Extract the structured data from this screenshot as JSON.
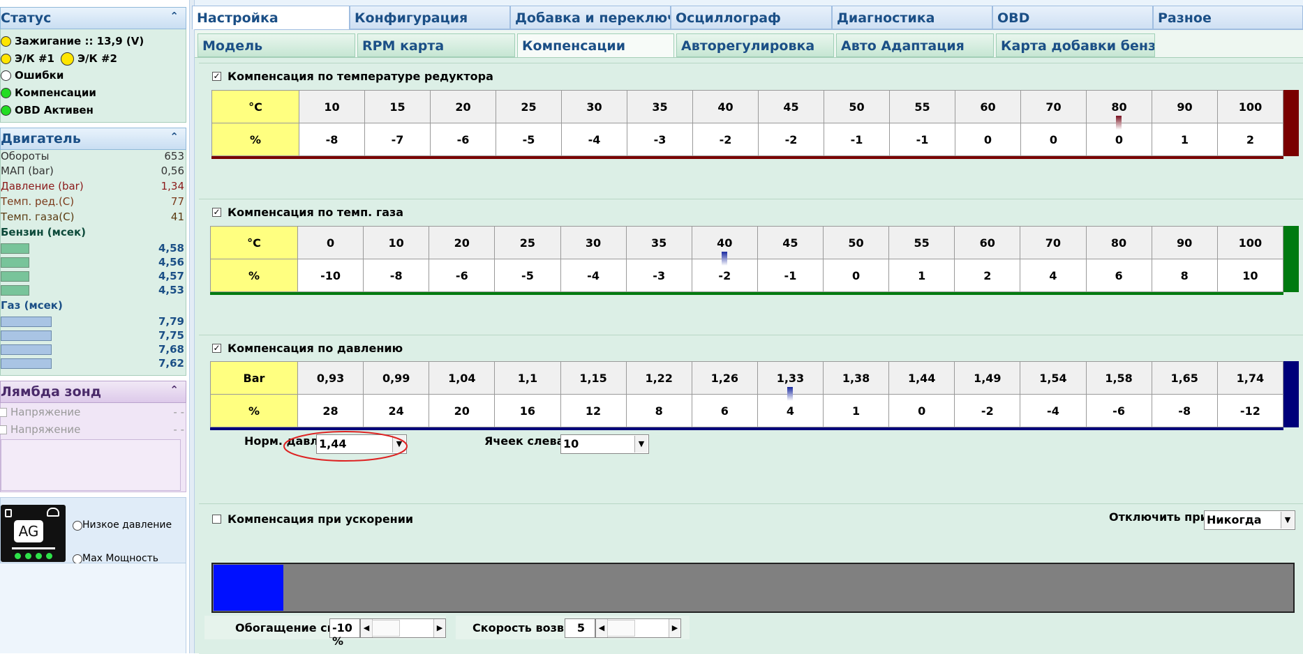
{
  "status": {
    "title": "Статус",
    "ignition": "Зажигание :: 13,9 (V)",
    "ek1": "Э/К #1",
    "ek2": "Э/К #2",
    "errors": "Ошибки",
    "compensation": "Компенсации",
    "obd": "OBD Активен"
  },
  "engine": {
    "title": "Двигатель",
    "rows": [
      {
        "label": "Обороты",
        "value": "653"
      },
      {
        "label": "МАП (bar)",
        "value": "0,56"
      },
      {
        "label": "Давление (bar)",
        "value": "1,34"
      },
      {
        "label": "Темп. ред.(C)",
        "value": "77"
      },
      {
        "label": "Темп. газа(C)",
        "value": "41"
      }
    ],
    "petrol_title": "Бензин (мсек)",
    "petrol": [
      "4,58",
      "4,56",
      "4,57",
      "4,53"
    ],
    "gas_title": "Газ (мсек)",
    "gas": [
      "7,79",
      "7,75",
      "7,68",
      "7,62"
    ]
  },
  "lambda": {
    "title": "Лямбда зонд",
    "rows": [
      {
        "label": "Напряжение",
        "value": "- -"
      },
      {
        "label": "Напряжение",
        "value": "- -"
      }
    ]
  },
  "device": {
    "logo": "AG",
    "low_pressure": "Низкое давление",
    "max_power": "Max Мощность"
  },
  "tabs": [
    "Настройка",
    "Конфигурация",
    "Добавка и переключен",
    "Осциллограф",
    "Диагностика",
    "OBD",
    "Разное"
  ],
  "subtabs": [
    "Модель",
    "RPM карта",
    "Компенсации",
    "Авторегулировка",
    "Авто Адаптация",
    "Карта добавки бензина"
  ],
  "reducer": {
    "title": "Компенсация по температуре редуктора",
    "checked": true,
    "row1_label": "°C",
    "row2_label": "%",
    "x": [
      "10",
      "15",
      "20",
      "25",
      "30",
      "35",
      "40",
      "45",
      "50",
      "55",
      "60",
      "70",
      "80",
      "90",
      "100"
    ],
    "y": [
      "-8",
      "-7",
      "-6",
      "-5",
      "-4",
      "-3",
      "-2",
      "-2",
      "-1",
      "-1",
      "0",
      "0",
      "0",
      "1",
      "2"
    ],
    "color": "#7a0000"
  },
  "gas_temp": {
    "title": "Компенсация по темп. газа",
    "checked": true,
    "row1_label": "°C",
    "row2_label": "%",
    "x": [
      "0",
      "10",
      "20",
      "25",
      "30",
      "35",
      "40",
      "45",
      "50",
      "55",
      "60",
      "70",
      "80",
      "90",
      "100"
    ],
    "y": [
      "-10",
      "-8",
      "-6",
      "-5",
      "-4",
      "-3",
      "-2",
      "-1",
      "0",
      "1",
      "2",
      "4",
      "6",
      "8",
      "10"
    ],
    "color": "#007a10"
  },
  "pressure": {
    "title": "Компенсация по давлению",
    "checked": true,
    "row1_label": "Bar",
    "row2_label": "%",
    "x": [
      "0,93",
      "0,99",
      "1,04",
      "1,1",
      "1,15",
      "1,22",
      "1,26",
      "1,33",
      "1,38",
      "1,44",
      "1,49",
      "1,54",
      "1,58",
      "1,65",
      "1,74"
    ],
    "y": [
      "28",
      "24",
      "20",
      "16",
      "12",
      "8",
      "6",
      "4",
      "1",
      "0",
      "-2",
      "-4",
      "-6",
      "-8",
      "-12"
    ],
    "color": "#00007a",
    "norm_label": "Норм. давл.",
    "norm_value": "1,44",
    "cells_label": "Ячеек слева",
    "cells_value": "10"
  },
  "accel": {
    "title": "Компенсация при ускорении",
    "checked": false,
    "disable_label": "Отключить при",
    "disable_value": "Никогда",
    "enrich_label": "Обогащение смеси",
    "enrich_value": "-10 %",
    "return_label": "Скорость возврата",
    "return_value": "5"
  }
}
